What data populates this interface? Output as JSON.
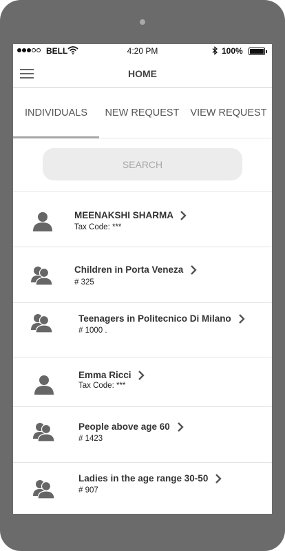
{
  "status": {
    "carrier": "BELL",
    "time": "4:20 PM",
    "battery": "100%"
  },
  "navbar": {
    "title": "HOME",
    "menu_icon": "hamburger-menu-icon"
  },
  "tabs": [
    {
      "label": "INDIVIDUALS",
      "active": true
    },
    {
      "label": "NEW REQUEST",
      "active": false
    },
    {
      "label": "VIEW REQUEST",
      "active": false
    }
  ],
  "search": {
    "placeholder": "SEARCH"
  },
  "items": [
    {
      "title": "MEENAKSHI SHARMA",
      "subtitle": "Tax Code: ***",
      "icon": "person-icon"
    },
    {
      "title": "Children in Porta Veneza",
      "subtitle": "# 325",
      "icon": "group-icon"
    },
    {
      "title": "Teenagers in Politecnico Di Milano",
      "subtitle": "# 1000 .",
      "icon": "group-icon"
    },
    {
      "title": "Emma Ricci",
      "subtitle": "Tax Code: ***",
      "icon": "person-icon"
    },
    {
      "title": "People above age 60",
      "subtitle": "# 1423",
      "icon": "group-icon"
    },
    {
      "title": "Ladies in the age range 30-50",
      "subtitle": "# 907",
      "icon": "group-icon"
    }
  ]
}
